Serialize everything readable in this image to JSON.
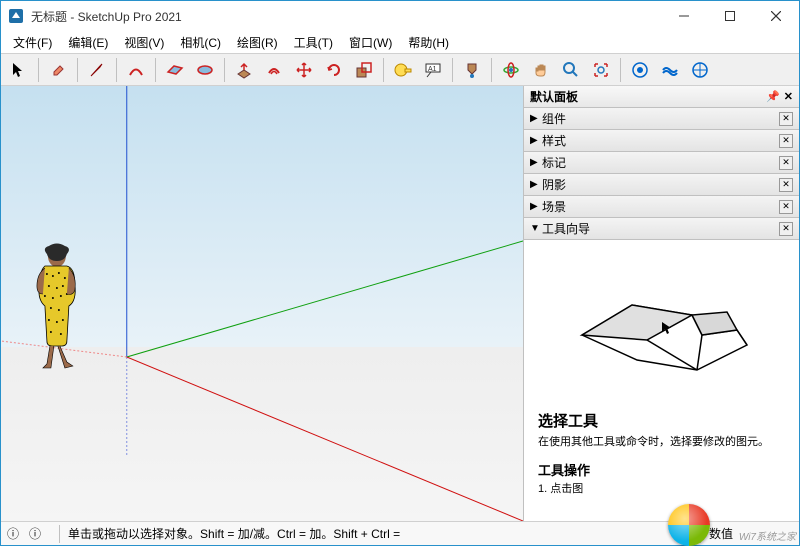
{
  "title": "无标题 - SketchUp Pro 2021",
  "menus": [
    "文件(F)",
    "编辑(E)",
    "视图(V)",
    "相机(C)",
    "绘图(R)",
    "工具(T)",
    "窗口(W)",
    "帮助(H)"
  ],
  "panel": {
    "title": "默认面板",
    "sections": [
      "组件",
      "样式",
      "标记",
      "阴影",
      "场景"
    ],
    "active": "工具向导"
  },
  "instructor": {
    "title": "选择工具",
    "desc": "在使用其他工具或命令时，选择要修改的图元。",
    "sub": "工具操作",
    "step": "1. 点击图"
  },
  "status": {
    "hint": "单击或拖动以选择对象。Shift = 加/减。Ctrl = 加。Shift + Ctrl = ",
    "label": "数值"
  },
  "watermark": "Wi7系统之家"
}
